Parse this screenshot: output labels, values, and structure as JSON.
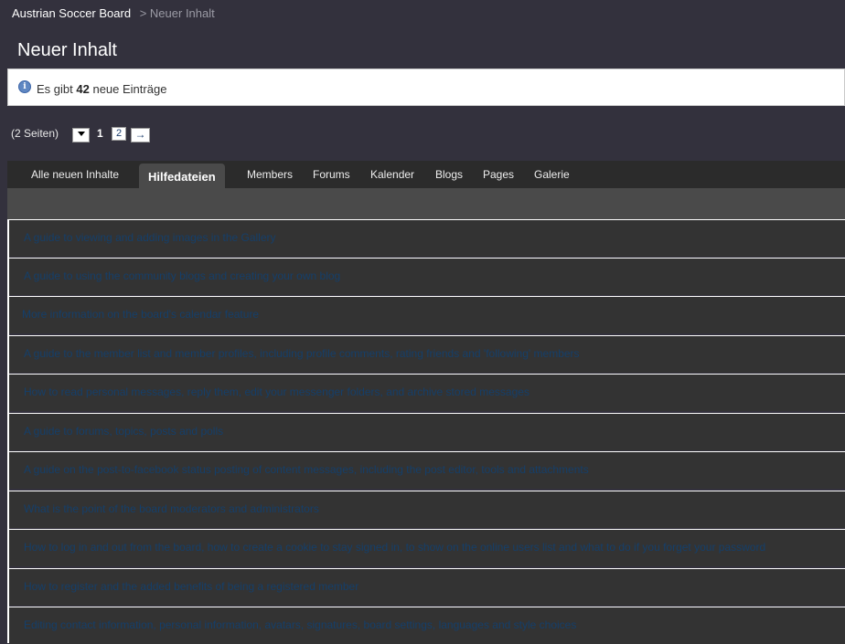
{
  "breadcrumb": {
    "home": "Austrian Soccer Board",
    "separator": ">",
    "current": "Neuer Inhalt"
  },
  "page_title": "Neuer Inhalt",
  "info": {
    "prefix": "Es gibt",
    "count": "42",
    "suffix": "neue Einträge"
  },
  "pagination": {
    "pages_label": "(2 Seiten)",
    "current": "1",
    "page2": "2",
    "next": "→"
  },
  "tabs": [
    {
      "label": "Alle neuen Inhalte"
    },
    {
      "label": "Hilfedateien"
    },
    {
      "label": "Members"
    },
    {
      "label": "Forums"
    },
    {
      "label": "Kalender"
    },
    {
      "label": "Blogs"
    },
    {
      "label": "Pages"
    },
    {
      "label": "Galerie"
    }
  ],
  "results": [
    "A guide to viewing and adding images in the Gallery",
    "A guide to using the community blogs and creating your own blog",
    "More information on the board's calendar feature",
    "A guide to the member list and member profiles, including profile comments, rating friends and 'following' members",
    "How to read personal messages, reply them, edit your messenger folders, and archive stored messages",
    "A guide to forums, topics, posts and polls",
    "A guide on the post-to-facebook status posting of content messages, including the post editor, tools and attachments",
    "What is the point of the board moderators and administrators",
    "How to log in and out from the board, how to create a cookie to stay signed in, to show on the online users list and what to do if you forget your password",
    "How to register and the added benefits of being a registered member",
    "Editing contact information, personal information, avatars, signatures, board settings, languages and style choices"
  ]
}
